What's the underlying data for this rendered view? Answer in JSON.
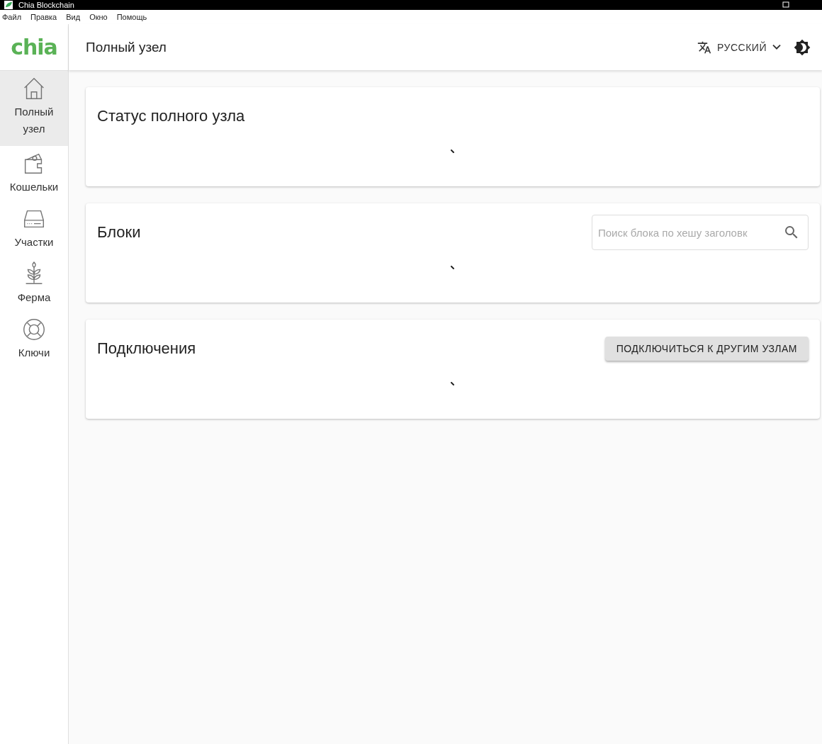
{
  "window": {
    "title": "Chia Blockchain"
  },
  "menu": [
    "Файл",
    "Правка",
    "Вид",
    "Окно",
    "Помощь"
  ],
  "header": {
    "logo": "chia",
    "title": "Полный узел",
    "language": "РУССКИЙ"
  },
  "sidebar": {
    "items": [
      {
        "kind": "home",
        "label": "Полный узел",
        "selected": true
      },
      {
        "kind": "wallet",
        "label": "Кошельки",
        "selected": false
      },
      {
        "kind": "drive",
        "label": "Участки",
        "selected": false
      },
      {
        "kind": "plant",
        "label": "Ферма",
        "selected": false
      },
      {
        "kind": "ring",
        "label": "Ключи",
        "selected": false
      }
    ]
  },
  "cards": [
    {
      "title": "Статус полного узла",
      "loading": true
    },
    {
      "title": "Блоки",
      "loading": true,
      "search": {
        "placeholder": "Поиск блока по хешу заголовк"
      }
    },
    {
      "title": "Подключения",
      "loading": true,
      "button": "ПОДКЛЮЧИТЬСЯ К ДРУГИМ УЗЛАМ"
    }
  ]
}
